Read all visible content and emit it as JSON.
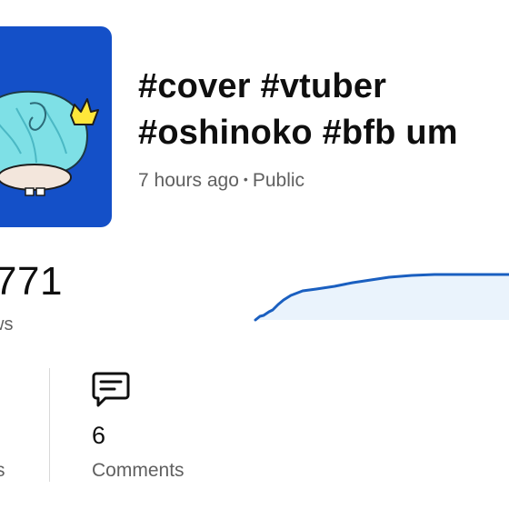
{
  "video": {
    "title_line1": "#cover #vtuber",
    "title_line2": "#oshinoko #bfb  um",
    "age": "7 hours ago",
    "separator": "•",
    "visibility": "Public"
  },
  "stats": {
    "views_value": "771",
    "views_label": "ws",
    "likes_label": "s",
    "comments_value": "6",
    "comments_label": "Comments"
  },
  "colors": {
    "thumbnail_bg": "#1450c8",
    "sparkline": "#1a5fc0",
    "sparkline_fill": "#eaf3fc"
  },
  "icons": {
    "comments": "comment-bubble-icon"
  }
}
